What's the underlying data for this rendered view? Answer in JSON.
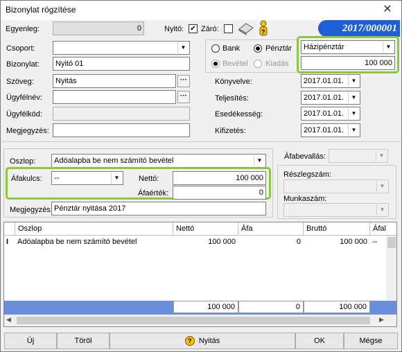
{
  "window": {
    "title": "Bizonylat rögzítése"
  },
  "top": {
    "egyenleg_label": "Egyenleg:",
    "egyenleg_value": "0",
    "nyito_label": "Nyitó:",
    "zaro_label": "Záró:",
    "doc_number": "2017/000001"
  },
  "form": {
    "csoport_label": "Csoport:",
    "bizonylat_label": "Bizonylat:",
    "bizonylat_value": "Nyitó 01",
    "szoveg_label": "Szöveg:",
    "szoveg_value": "Nyitás",
    "ugyfelnev_label": "Ügyfélnév:",
    "ugyfelkod_label": "Ügyfélkód:",
    "megjegyzes_label": "Megjegyzés:"
  },
  "right": {
    "bank_label": "Bank",
    "penztar_label": "Pénztár",
    "penztar_select": "Házipénztár",
    "bevetel_label": "Bevétel",
    "kiadas_label": "Kiadás",
    "amount": "100 000",
    "konyvelve_label": "Könyvelve:",
    "teljesites_label": "Teljesítés:",
    "esedekesseg_label": "Esedékesség:",
    "kifizetes_label": "Kifizetés:",
    "date": "2017.01.01."
  },
  "item": {
    "oszlop_label": "Oszlop:",
    "oszlop_value": "Adóalapba be nem számító bevétel",
    "afakulcs_label": "Áfakulcs:",
    "afakulcs_value": "--",
    "netto_label": "Nettó:",
    "netto_value": "100 000",
    "afaertek_label": "Áfaérték:",
    "afaertek_value": "0",
    "megjegyzes_label": "Megjegyzés:",
    "megjegyzes_value": "Pénztár nyitása 2017"
  },
  "side": {
    "afabevallas_label": "Áfabevallás:",
    "reszlegszam_label": "Részlegszám:",
    "munkaszam_label": "Munkaszám:"
  },
  "table": {
    "columns": [
      "Oszlop",
      "Nettó",
      "Áfa",
      "Bruttó",
      "Áfal"
    ],
    "rows": [
      {
        "marker": "I",
        "oszlop": "Adóalapba be nem számító bevétel",
        "netto": "100 000",
        "afa": "0",
        "brutto": "100 000",
        "afal": "--"
      }
    ],
    "totals": {
      "netto": "100 000",
      "afa": "0",
      "brutto": "100 000"
    }
  },
  "buttons": {
    "uj": "Új",
    "torol": "Töröl",
    "nyitas": "Nyitás",
    "ok": "OK",
    "megse": "Mégse"
  }
}
